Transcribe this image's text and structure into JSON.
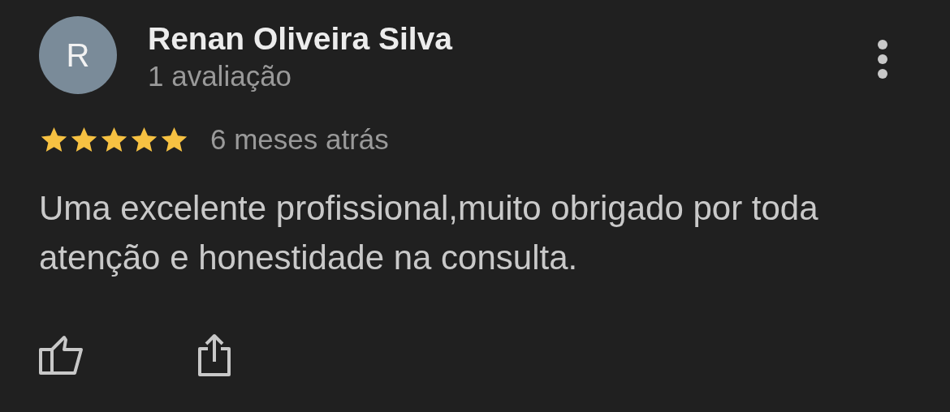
{
  "review": {
    "avatar_letter": "R",
    "author": "Renan Oliveira Silva",
    "author_meta": "1 avaliação",
    "stars": 5,
    "time": "6 meses atrás",
    "text": "Uma excelente profissional,muito obrigado por toda atenção e honestidade na consulta."
  }
}
